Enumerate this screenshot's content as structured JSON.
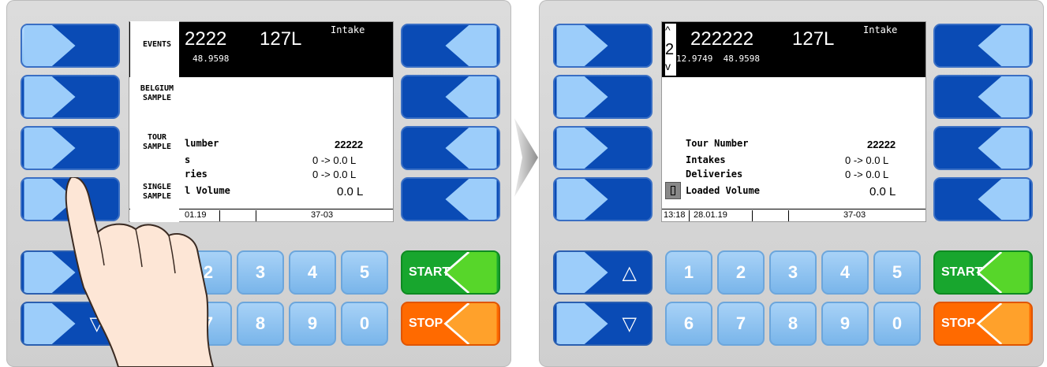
{
  "left_screen": {
    "menu": [
      "EVENTS",
      "BELGIUM SAMPLE",
      "TOUR SAMPLE",
      "SINGLE SAMPLE"
    ],
    "header": {
      "number": "2222",
      "volume": "127L",
      "mode": "Intake",
      "coords": "48.9598"
    },
    "rows": [
      {
        "label": "lumber",
        "value": "22222"
      },
      {
        "label": "s",
        "value": "0 -> 0.0 L"
      },
      {
        "label": "ries",
        "value": "0 -> 0.0 L"
      },
      {
        "label": "l Volume",
        "value": "0.0 L"
      }
    ],
    "status": {
      "date": "01.19",
      "code": "37-03"
    }
  },
  "right_screen": {
    "header": {
      "number": "222222",
      "index": "2",
      "volume": "127L",
      "mode": "Intake",
      "coords": "12.9749  48.9598"
    },
    "rows": [
      {
        "label": "Tour Number",
        "value": "22222"
      },
      {
        "label": "Intakes",
        "value": "0 -> 0.0 L"
      },
      {
        "label": "Deliveries",
        "value": "0 -> 0.0 L"
      },
      {
        "label": "Loaded Volume",
        "value": "0.0 L"
      }
    ],
    "status": {
      "time": "13:18",
      "date": "28.01.19",
      "code": "37-03"
    }
  },
  "keypad": {
    "left_digits": [
      "2",
      "3",
      "4",
      "5",
      "7",
      "8",
      "9",
      "0"
    ],
    "right_digits": [
      "1",
      "2",
      "3",
      "4",
      "5",
      "6",
      "7",
      "8",
      "9",
      "0"
    ],
    "up_glyph": "△",
    "down_glyph": "▽",
    "start_label": "START",
    "stop_label": "STOP"
  },
  "icons": [
    "chevron-right-icon",
    "chevron-left-icon",
    "pointing-hand-icon",
    "transition-arrow-icon",
    "fuel-icon"
  ],
  "colors": {
    "dark_blue": "#0a4bb5",
    "light_blue": "#8cc4f4",
    "start_green": "#18a62e",
    "stop_orange": "#ff6a00"
  }
}
